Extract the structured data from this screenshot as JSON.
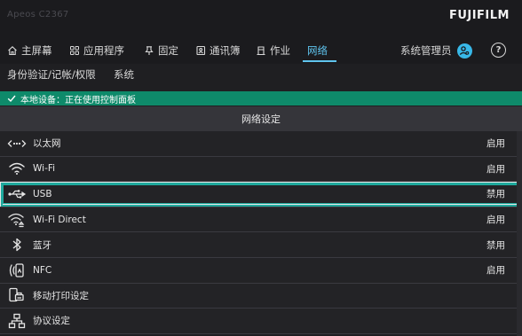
{
  "header": {
    "device_name": "Apeos C2367",
    "brand": "FUJIFILM"
  },
  "tabs": [
    {
      "label": "主屏幕",
      "icon": "home-icon"
    },
    {
      "label": "应用程序",
      "icon": "apps-grid-icon"
    },
    {
      "label": "固定",
      "icon": "pin-icon"
    },
    {
      "label": "通讯簿",
      "icon": "address-book-icon"
    },
    {
      "label": "作业",
      "icon": "job-icon"
    },
    {
      "label": "网络",
      "icon": ""
    }
  ],
  "active_tab": "网络",
  "admin": {
    "label": "系统管理员",
    "icon": "admin-user-icon"
  },
  "help": {
    "label": "?",
    "icon": "help-icon"
  },
  "subtabs": [
    "身份验证/记帐/权限",
    "系统"
  ],
  "status": {
    "text": "本地设备：正在使用控制面板",
    "icon": "check-icon"
  },
  "section": {
    "title": "网络设定"
  },
  "rows": [
    {
      "label": "以太网",
      "value": "启用",
      "icon": "ethernet-icon"
    },
    {
      "label": "Wi-Fi",
      "value": "启用",
      "icon": "wifi-icon"
    },
    {
      "label": "USB",
      "value": "禁用",
      "icon": "usb-icon"
    },
    {
      "label": "Wi-Fi Direct",
      "value": "启用",
      "icon": "wifi-direct-icon"
    },
    {
      "label": "蓝牙",
      "value": "禁用",
      "icon": "bluetooth-icon"
    },
    {
      "label": "NFC",
      "value": "启用",
      "icon": "nfc-icon"
    },
    {
      "label": "移动打印设定",
      "value": "",
      "icon": "mobile-print-icon"
    },
    {
      "label": "协议设定",
      "value": "",
      "icon": "protocol-network-icon"
    }
  ],
  "selected_row": "USB",
  "colors": {
    "accent": "#5fc4ee",
    "status_green": "#0e8a6a",
    "selection": "#1fa99d",
    "background": "#1f1f22"
  }
}
